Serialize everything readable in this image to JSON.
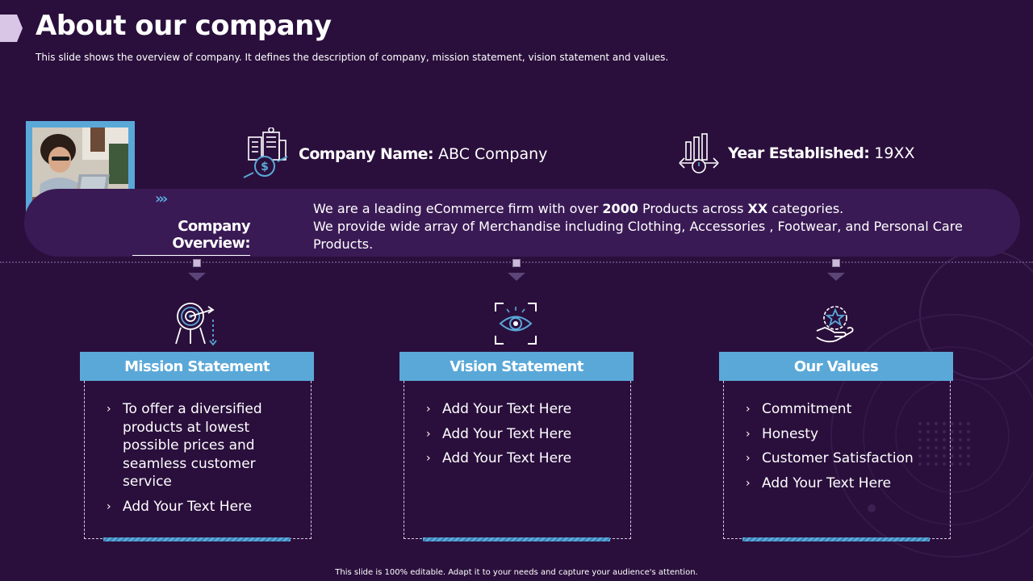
{
  "header": {
    "title": "About our company",
    "subtitle": "This slide shows the overview of company. It defines the description of company, mission statement, vision statement and values."
  },
  "company": {
    "name_label": "Company Name:",
    "name_value": "ABC Company",
    "year_label": "Year Established:",
    "year_value": "19XX"
  },
  "overview": {
    "label": "Company Overview:",
    "line1_pre": "We are a leading eCommerce firm with over ",
    "line1_bold1": "2000",
    "line1_mid": " Products across ",
    "line1_bold2": "XX",
    "line1_post": " categories.",
    "line2": "We provide wide array of Merchandise including Clothing, Accessories , Footwear, and Personal Care Products."
  },
  "columns": [
    {
      "title": "Mission Statement",
      "icon": "target-icon",
      "items": [
        "To offer a diversified products at lowest possible prices and seamless customer service",
        "Add Your Text Here"
      ]
    },
    {
      "title": "Vision Statement",
      "icon": "eye-icon",
      "items": [
        "Add Your Text Here",
        "Add Your Text Here",
        "Add Your Text Here"
      ]
    },
    {
      "title": "Our Values",
      "icon": "hand-star-icon",
      "items": [
        "Commitment",
        "Honesty",
        "Customer Satisfaction",
        "Add Your Text Here"
      ]
    }
  ],
  "footer": {
    "text": "This slide is 100% editable. Adapt it to your needs and capture your audience's attention."
  },
  "colors": {
    "background": "#2a0f3c",
    "accent": "#5aa8d8",
    "band": "#3a1a55"
  }
}
